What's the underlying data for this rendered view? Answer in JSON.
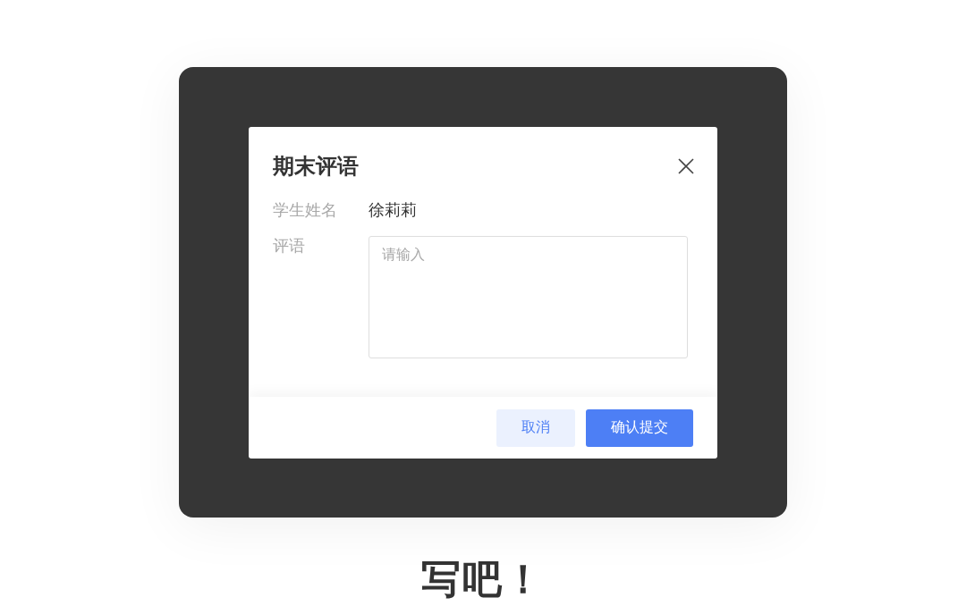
{
  "dialog": {
    "title": "期末评语",
    "fields": [
      {
        "kind": "text",
        "label": "学生姓名",
        "value": "徐莉莉"
      },
      {
        "kind": "textarea",
        "label": "评语",
        "placeholder": "请输入"
      }
    ],
    "buttons": [
      {
        "label": "取消",
        "kind": "secondary"
      },
      {
        "label": "确认提交",
        "kind": "primary"
      }
    ]
  },
  "caption": "写吧！"
}
